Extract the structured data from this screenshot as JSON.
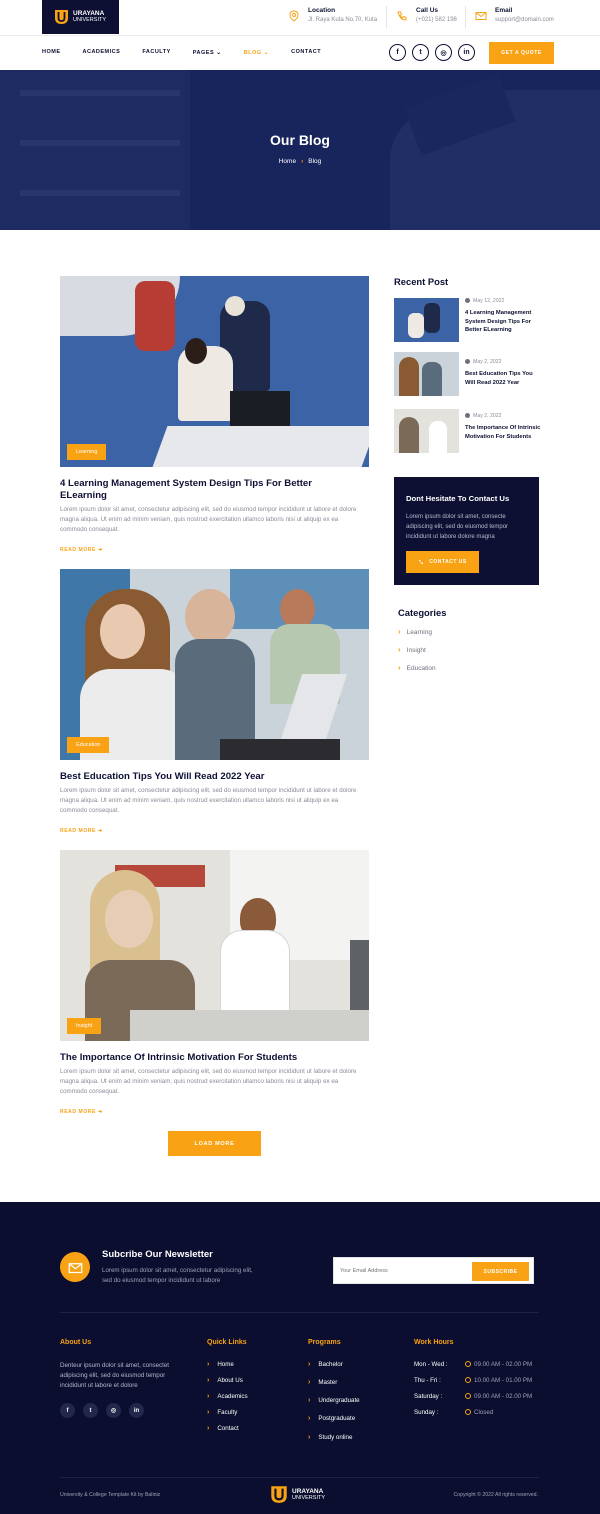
{
  "header": {
    "logo": {
      "line1": "URAYANA",
      "line2": "UNIVERSITY"
    },
    "contacts": [
      {
        "icon": "location-pin-icon",
        "label": "Location",
        "value": "Jl. Raya Kuta No.70, Kuta"
      },
      {
        "icon": "phone-icon",
        "label": "Call Us",
        "value": "(+021) 582 198"
      },
      {
        "icon": "mail-icon",
        "label": "Email",
        "value": "support@domain.com"
      }
    ]
  },
  "nav": {
    "items": [
      "HOME",
      "ACADEMICS",
      "FACULTY",
      "PAGES",
      "BLOG",
      "CONTACT"
    ],
    "caret": "⌄",
    "social": [
      "f",
      "t",
      "◎",
      "in"
    ],
    "quote_button": "GET A QUOTE"
  },
  "hero": {
    "title": "Our Blog",
    "crumb_home": "Home",
    "crumb_sep": "›",
    "crumb_current": "Blog"
  },
  "posts": [
    {
      "tag": "Learning",
      "title": "4 Learning Management System Design Tips For Better ELearning",
      "excerpt": "Lorem ipsum dolor sit amet, consectetur adipiscing elit, sed do eiusmod tempor incididunt ut labore et dolore magna aliqua. Ut enim ad minim veniam, quis nostrud exercitation ullamco laboris nisi ut aliquip ex ea commodo consequat.",
      "read_more": "READ MORE ➔"
    },
    {
      "tag": "Education",
      "title": "Best Education Tips You Will Read 2022 Year",
      "excerpt": "Lorem ipsum dolor sit amet, consectetur adipiscing elit, sed do eiusmod tempor incididunt ut labore et dolore magna aliqua. Ut enim ad minim veniam, quis nostrud exercitation ullamco laboris nisi ut aliquip ex ea commodo consequat.",
      "read_more": "READ MORE ➔"
    },
    {
      "tag": "Insight",
      "title": "The Importance Of Intrinsic Motivation For Students",
      "excerpt": "Lorem ipsum dolor sit amet, consectetur adipiscing elit, sed do eiusmod tempor incididunt ut labore et dolore magna aliqua. Ut enim ad minim veniam, quis nostrud exercitation ullamco laboris nisi ut aliquip ex ea commodo consequat.",
      "read_more": "READ MORE ➔"
    }
  ],
  "load_more": "LOAD MORE",
  "sidebar": {
    "recent_heading": "Recent Post",
    "recent": [
      {
        "date": "May 12, 2022",
        "title": "4 Learning Management System Design Tips For Better ELearning"
      },
      {
        "date": "May 2, 2022",
        "title": "Best Education Tips You Will Read 2022 Year"
      },
      {
        "date": "May 2, 2022",
        "title": "The Importance Of Intrinsic Motivation For Students"
      }
    ],
    "contact_box": {
      "title": "Dont Hesitate To Contact Us",
      "text": "Lorem ipsum dolor sit amet, consecte adipiscing elit, sed do eiusmod tempor incididunt ut labore dolore magna",
      "button": "CONTACT US"
    },
    "categories_heading": "Categories",
    "categories": [
      "Learning",
      "Insight",
      "Education"
    ]
  },
  "footer": {
    "newsletter": {
      "title": "Subcribe Our Newsletter",
      "text": "Lorem ipsum dolor sit amet, consectetur adipiscing elit, sed do eiusmod tempor incididunt ut labore",
      "placeholder": "Your Email Address",
      "button": "SUBSCRIBE"
    },
    "about": {
      "heading": "About Us",
      "text": "Denteur ipsum dolor sit amet, consectet adipiscing elit, sed do eiusmod tempor incididunt ut labore et dolore"
    },
    "quick_links": {
      "heading": "Quick Links",
      "items": [
        "Home",
        "About Us",
        "Academics",
        "Faculty",
        "Contact"
      ]
    },
    "programs": {
      "heading": "Programs",
      "items": [
        "Bachelor",
        "Master",
        "Undergraduate",
        "Postgraduate",
        "Study online"
      ]
    },
    "work_hours": {
      "heading": "Work Hours",
      "rows": [
        {
          "day": "Mon - Wed :",
          "hours": "09.00 AM - 02.00 PM"
        },
        {
          "day": "Thu - Fri :",
          "hours": "10.00 AM - 01.00 PM"
        },
        {
          "day": "Saturday :",
          "hours": "09.00 AM - 02.00 PM"
        },
        {
          "day": "Sunday :",
          "hours": "Closed"
        }
      ]
    },
    "credit": "University & College Template Kit by Baliniz",
    "copyright": "Copyright © 2022 All rights reserved."
  },
  "colors": {
    "accent": "#f8a214",
    "navy": "#0d1033",
    "footer_bg": "#0b0e2e"
  }
}
